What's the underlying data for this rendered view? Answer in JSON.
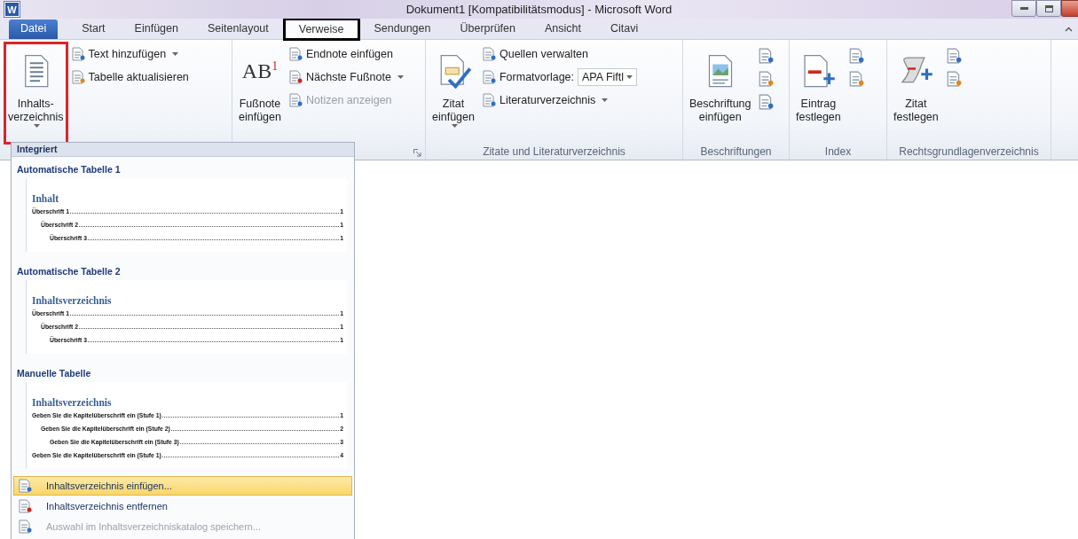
{
  "window": {
    "app_icon": "W",
    "title": "Dokument1 [Kompatibilitätsmodus] - Microsoft Word"
  },
  "tabs": [
    {
      "label": "Datei",
      "kind": "file",
      "selected": false,
      "annotated": false
    },
    {
      "label": "Start",
      "kind": "tab",
      "selected": false,
      "annotated": false
    },
    {
      "label": "Einfügen",
      "kind": "tab",
      "selected": false,
      "annotated": false
    },
    {
      "label": "Seitenlayout",
      "kind": "tab",
      "selected": false,
      "annotated": false
    },
    {
      "label": "Verweise",
      "kind": "tab",
      "selected": true,
      "annotated": true
    },
    {
      "label": "Sendungen",
      "kind": "tab",
      "selected": false,
      "annotated": false
    },
    {
      "label": "Überprüfen",
      "kind": "tab",
      "selected": false,
      "annotated": false
    },
    {
      "label": "Ansicht",
      "kind": "tab",
      "selected": false,
      "annotated": false
    },
    {
      "label": "Citavi",
      "kind": "tab",
      "selected": false,
      "annotated": false
    }
  ],
  "ribbon_groups": [
    {
      "items": [
        {
          "kind": "large",
          "label": "Inhalts-\nverzeichnis",
          "dropdown": true,
          "annotated": true
        },
        {
          "kind": "column",
          "items": [
            {
              "label": "Text hinzufügen",
              "dropdown": true,
              "disabled": false
            },
            {
              "label": "Tabelle aktualisieren",
              "dropdown": false,
              "disabled": false
            }
          ]
        }
      ]
    },
    {
      "launcher": true,
      "items": [
        {
          "kind": "large",
          "label": "Fußnote\neinfügen",
          "icon_label": "AB$^{1}$",
          "dropdown": false,
          "annotated": false
        },
        {
          "kind": "column",
          "items": [
            {
              "label": "Endnote einfügen",
              "dropdown": false,
              "disabled": false
            },
            {
              "label": "Nächste Fußnote",
              "dropdown": true,
              "disabled": false
            },
            {
              "label": "Notizen anzeigen",
              "dropdown": false,
              "disabled": true
            }
          ]
        }
      ]
    },
    {
      "label": "Zitate und Literaturverzeichnis",
      "items": [
        {
          "kind": "large",
          "label": "Zitat\neinfügen",
          "dropdown": true,
          "annotated": false
        },
        {
          "kind": "column",
          "items": [
            {
              "label": "Quellen verwalten",
              "dropdown": false,
              "disabled": false
            },
            {
              "label": "Formatvorlage:",
              "value": "APA Fiftl",
              "dropdown": true,
              "disabled": false
            },
            {
              "label": "Literaturverzeichnis",
              "dropdown": true,
              "disabled": false
            }
          ]
        }
      ]
    },
    {
      "label": "Beschriftungen",
      "items": [
        {
          "kind": "large",
          "label": "Beschriftung\neinfügen",
          "dropdown": false,
          "annotated": false
        },
        {
          "kind": "icons"
        }
      ]
    },
    {
      "label": "Index",
      "items": [
        {
          "kind": "large",
          "label": "Eintrag\nfestlegen",
          "dropdown": false,
          "annotated": false
        },
        {
          "kind": "icons"
        }
      ]
    },
    {
      "label": "Rechtsgrundlagenverzeichnis",
      "items": [
        {
          "kind": "large",
          "label": "Zitat\nfestlegen",
          "dropdown": false,
          "annotated": false
        },
        {
          "kind": "icons"
        }
      ]
    }
  ],
  "toc_menu": {
    "header": "Integriert",
    "sections": [
      {
        "title": "Automatische Tabelle 1",
        "preview": {
          "heading": "Inhalt",
          "entries": [
            {
              "text": "Überschrift 1",
              "page": "1",
              "children": [
                {
                  "text": "Überschrift 2",
                  "page": "1",
                  "children": [
                    {
                      "text": "Überschrift 3",
                      "page": "1"
                    }
                  ]
                }
              ]
            }
          ]
        }
      },
      {
        "title": "Automatische Tabelle 2",
        "preview": {
          "heading": "Inhaltsverzeichnis",
          "entries": [
            {
              "text": "Überschrift 1",
              "page": "1",
              "children": [
                {
                  "text": "Überschrift 2",
                  "page": "1",
                  "children": [
                    {
                      "text": "Überschrift 3",
                      "page": "1"
                    }
                  ]
                }
              ]
            }
          ]
        }
      },
      {
        "title": "Manuelle Tabelle",
        "preview": {
          "heading": "Inhaltsverzeichnis",
          "entries": [
            {
              "text": "Geben Sie die Kapitelüberschrift ein (Stufe 1)",
              "page": "1",
              "children": [
                {
                  "text": "Geben Sie die Kapitelüberschrift ein (Stufe 2)",
                  "page": "2",
                  "children": [
                    {
                      "text": "Geben Sie die Kapitelüberschrift ein (Stufe 3)",
                      "page": "3"
                    }
                  ]
                }
              ]
            },
            {
              "text": "Geben Sie die Kapitelüberschrift ein (Stufe 1)",
              "page": "4"
            }
          ]
        }
      }
    ],
    "commands": [
      {
        "label": "Inhaltsverzeichnis einfügen...",
        "selected": true,
        "disabled": false
      },
      {
        "label": "Inhaltsverzeichnis entfernen",
        "selected": false,
        "disabled": false
      },
      {
        "label": "Auswahl im Inhaltsverzeichniskatalog speichern...",
        "selected": false,
        "disabled": true
      }
    ]
  }
}
